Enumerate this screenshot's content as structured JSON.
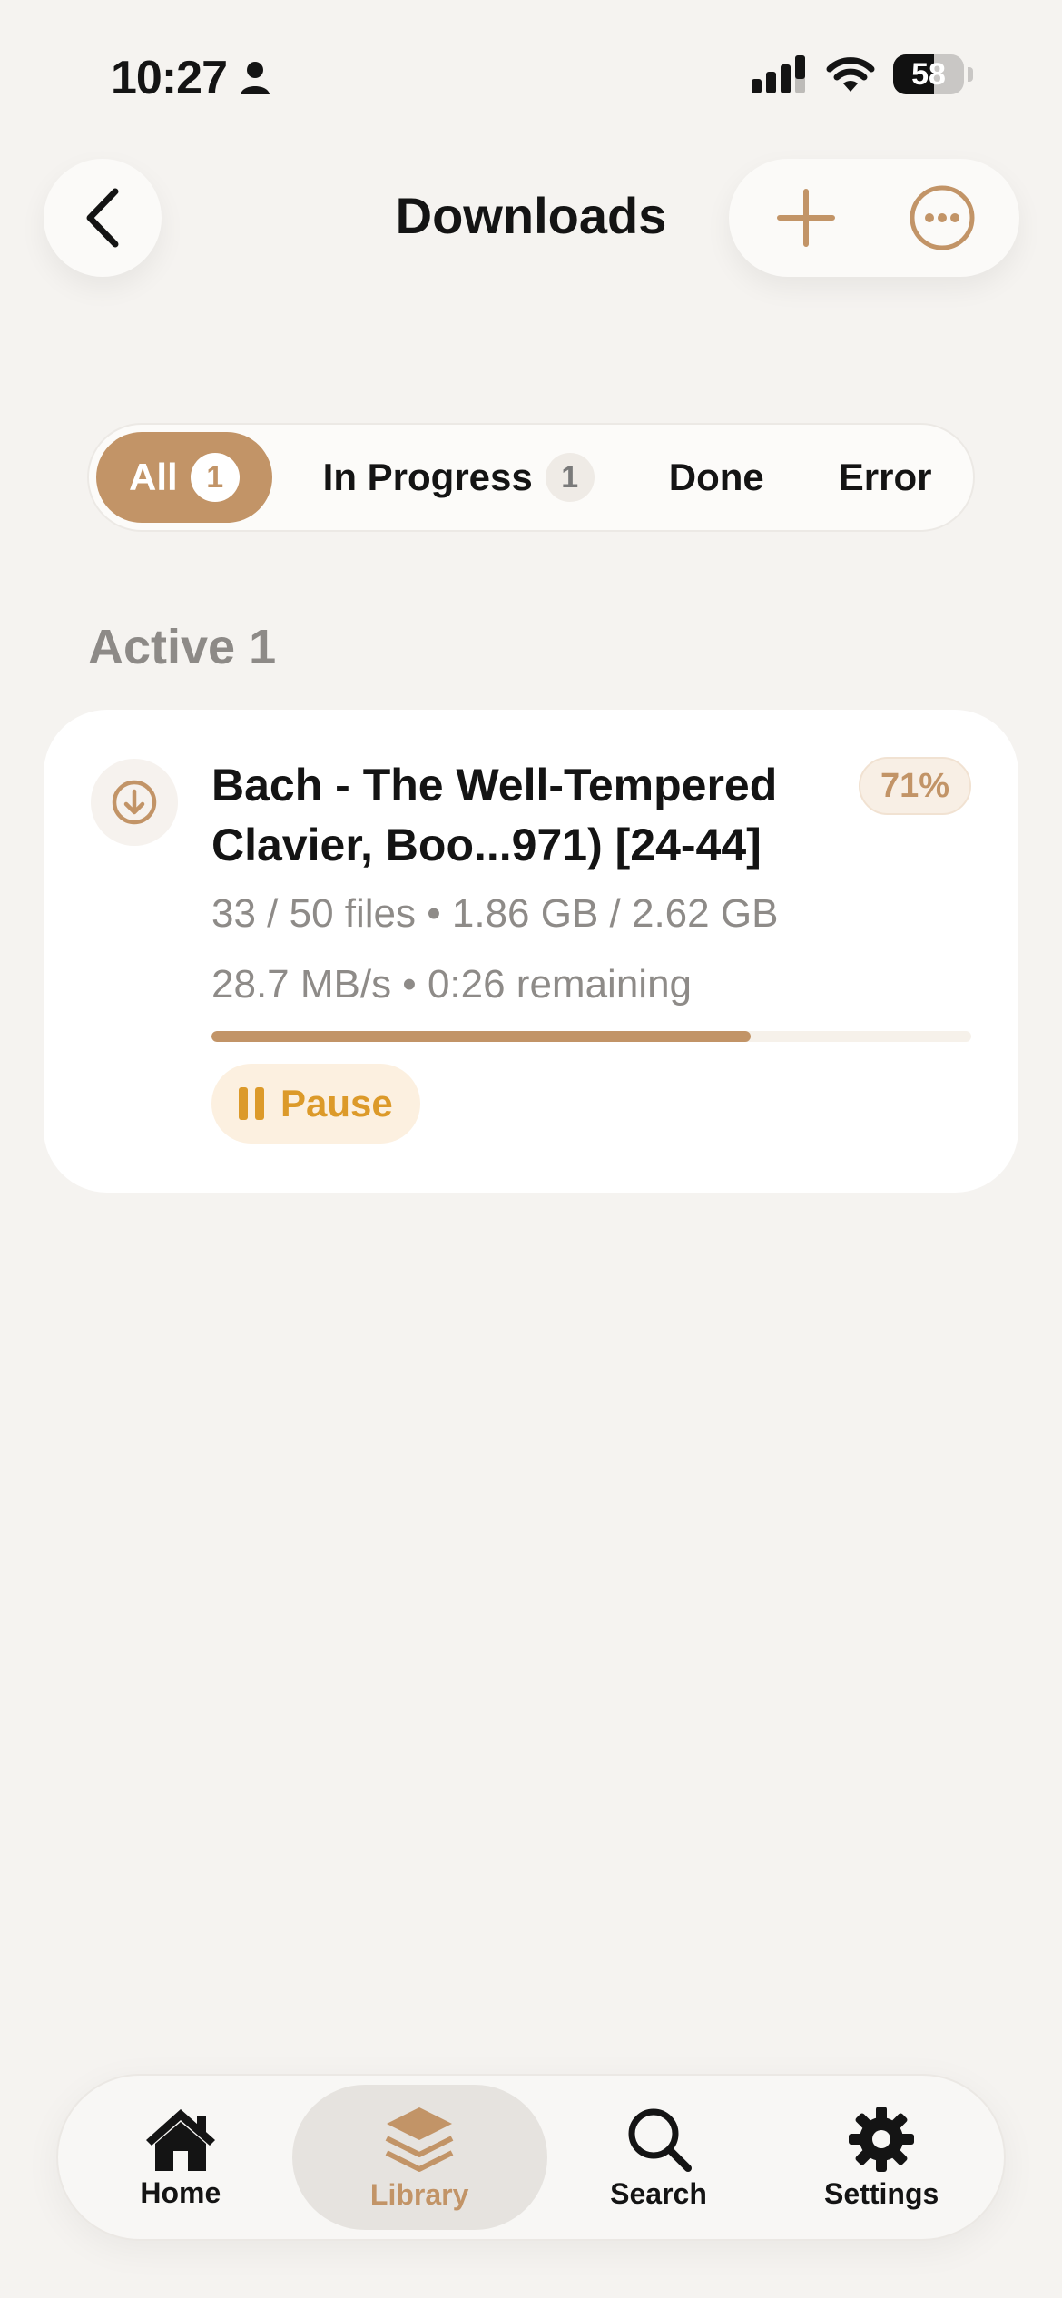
{
  "status_bar": {
    "time": "10:27",
    "battery": "58"
  },
  "header": {
    "title": "Downloads"
  },
  "filters": [
    {
      "label": "All",
      "count": "1"
    },
    {
      "label": "In Progress",
      "count": "1"
    },
    {
      "label": "Done"
    },
    {
      "label": "Error"
    }
  ],
  "section": {
    "title": "Active 1"
  },
  "download": {
    "title": "Bach - The Well-Tempered Clavier, Boo...971) [24-44]",
    "percent_label": "71%",
    "files_info": "33 / 50 files • 1.86 GB / 2.62 GB",
    "speed_info": "28.7 MB/s • 0:26 remaining",
    "progress": 0.71,
    "pause_label": "Pause"
  },
  "tabbar": {
    "items": [
      {
        "label": "Home",
        "icon": "home-icon"
      },
      {
        "label": "Library",
        "icon": "library-icon"
      },
      {
        "label": "Search",
        "icon": "search-icon"
      },
      {
        "label": "Settings",
        "icon": "gear-icon"
      }
    ]
  },
  "colors": {
    "accent": "#c29467",
    "pause": "#dc9a2a",
    "background": "#f5f3f0"
  }
}
